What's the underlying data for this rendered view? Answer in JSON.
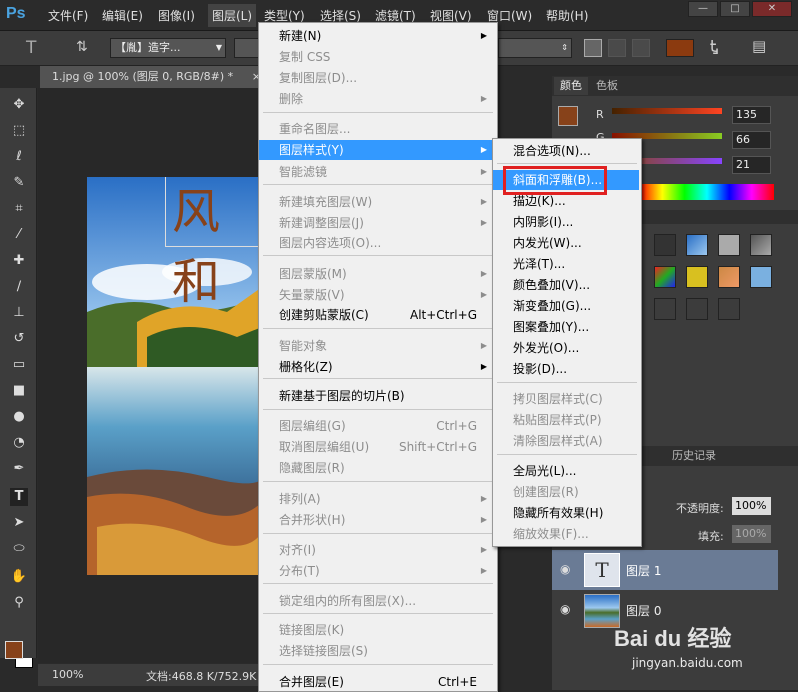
{
  "app": {
    "logo": "Ps"
  },
  "menubar": {
    "items": [
      "文件(F)",
      "编辑(E)",
      "图像(I)",
      "图层(L)",
      "类型(Y)",
      "选择(S)",
      "滤镜(T)",
      "视图(V)",
      "窗口(W)",
      "帮助(H)"
    ],
    "active": "图层(L)"
  },
  "window_controls": {
    "minimize": "—",
    "maximize": "□",
    "close": "✕"
  },
  "options": {
    "font_family": "【胤】造字...",
    "font_color": "#8b3a0f"
  },
  "document": {
    "tab_title": "1.jpg @ 100% (图层 0, RGB/8#) *",
    "tab_close": "×",
    "canvas_text": "风和",
    "zoom": "100%",
    "doc_info": "文档:468.8 K/752.9K"
  },
  "color_panel": {
    "tabs": [
      "颜色",
      "色板"
    ],
    "channels": [
      {
        "label": "R",
        "value": "135"
      },
      {
        "label": "G",
        "value": "66"
      },
      {
        "label": "B",
        "value": "21"
      }
    ],
    "foreground": "#87421a"
  },
  "layers_panel": {
    "tabs": [
      "路径",
      "历史记录"
    ],
    "opacity_label": "不透明度:",
    "opacity_value": "100%",
    "fill_label": "填充:",
    "fill_value": "100%",
    "layers": [
      {
        "name": "图层 1",
        "thumb": "T",
        "selected": true
      },
      {
        "name": "图层 0",
        "thumb": "photo",
        "selected": false
      }
    ]
  },
  "layer_menu": {
    "items": [
      {
        "label": "新建(N)",
        "shortcut": "",
        "disabled": false,
        "submenu": true
      },
      {
        "label": "复制 CSS",
        "shortcut": "",
        "disabled": true,
        "submenu": false
      },
      {
        "label": "复制图层(D)...",
        "shortcut": "",
        "disabled": true,
        "submenu": false
      },
      {
        "label": "删除",
        "shortcut": "",
        "disabled": true,
        "submenu": true
      },
      {
        "label": "重命名图层...",
        "shortcut": "",
        "disabled": true,
        "submenu": false
      },
      {
        "label": "图层样式(Y)",
        "shortcut": "",
        "disabled": false,
        "submenu": true,
        "highlight": true
      },
      {
        "label": "智能滤镜",
        "shortcut": "",
        "disabled": true,
        "submenu": true
      },
      {
        "label": "新建填充图层(W)",
        "shortcut": "",
        "disabled": true,
        "submenu": true
      },
      {
        "label": "新建调整图层(J)",
        "shortcut": "",
        "disabled": true,
        "submenu": true
      },
      {
        "label": "图层内容选项(O)...",
        "shortcut": "",
        "disabled": true,
        "submenu": false
      },
      {
        "label": "图层蒙版(M)",
        "shortcut": "",
        "disabled": true,
        "submenu": true
      },
      {
        "label": "矢量蒙版(V)",
        "shortcut": "",
        "disabled": true,
        "submenu": true
      },
      {
        "label": "创建剪贴蒙版(C)",
        "shortcut": "Alt+Ctrl+G",
        "disabled": false,
        "submenu": false
      },
      {
        "label": "智能对象",
        "shortcut": "",
        "disabled": true,
        "submenu": true
      },
      {
        "label": "栅格化(Z)",
        "shortcut": "",
        "disabled": false,
        "submenu": true
      },
      {
        "label": "新建基于图层的切片(B)",
        "shortcut": "",
        "disabled": false,
        "submenu": false
      },
      {
        "label": "图层编组(G)",
        "shortcut": "Ctrl+G",
        "disabled": true,
        "submenu": false
      },
      {
        "label": "取消图层编组(U)",
        "shortcut": "Shift+Ctrl+G",
        "disabled": true,
        "submenu": false
      },
      {
        "label": "隐藏图层(R)",
        "shortcut": "",
        "disabled": true,
        "submenu": false
      },
      {
        "label": "排列(A)",
        "shortcut": "",
        "disabled": true,
        "submenu": true
      },
      {
        "label": "合并形状(H)",
        "shortcut": "",
        "disabled": true,
        "submenu": true
      },
      {
        "label": "对齐(I)",
        "shortcut": "",
        "disabled": true,
        "submenu": true
      },
      {
        "label": "分布(T)",
        "shortcut": "",
        "disabled": true,
        "submenu": true
      },
      {
        "label": "锁定组内的所有图层(X)...",
        "shortcut": "",
        "disabled": true,
        "submenu": false
      },
      {
        "label": "链接图层(K)",
        "shortcut": "",
        "disabled": true,
        "submenu": false
      },
      {
        "label": "选择链接图层(S)",
        "shortcut": "",
        "disabled": true,
        "submenu": false
      },
      {
        "label": "合并图层(E)",
        "shortcut": "Ctrl+E",
        "disabled": false,
        "submenu": false
      }
    ]
  },
  "style_submenu": {
    "items": [
      {
        "label": "混合选项(N)...",
        "disabled": false
      },
      {
        "label": "斜面和浮雕(B)...",
        "disabled": false,
        "highlight": true
      },
      {
        "label": "描边(K)...",
        "disabled": false
      },
      {
        "label": "内阴影(I)...",
        "disabled": false
      },
      {
        "label": "内发光(W)...",
        "disabled": false
      },
      {
        "label": "光泽(T)...",
        "disabled": false
      },
      {
        "label": "颜色叠加(V)...",
        "disabled": false
      },
      {
        "label": "渐变叠加(G)...",
        "disabled": false
      },
      {
        "label": "图案叠加(Y)...",
        "disabled": false
      },
      {
        "label": "外发光(O)...",
        "disabled": false
      },
      {
        "label": "投影(D)...",
        "disabled": false
      },
      {
        "label": "拷贝图层样式(C)",
        "disabled": true
      },
      {
        "label": "粘贴图层样式(P)",
        "disabled": true
      },
      {
        "label": "清除图层样式(A)",
        "disabled": true
      },
      {
        "label": "全局光(L)...",
        "disabled": false
      },
      {
        "label": "创建图层(R)",
        "disabled": true
      },
      {
        "label": "隐藏所有效果(H)",
        "disabled": false
      },
      {
        "label": "缩放效果(F)...",
        "disabled": true
      }
    ]
  },
  "watermark": {
    "brand": "Bai du 经验",
    "url": "jingyan.baidu.com"
  }
}
